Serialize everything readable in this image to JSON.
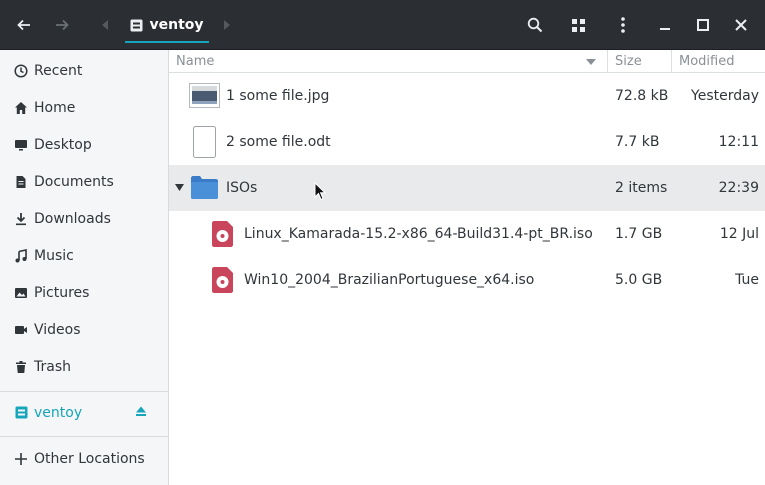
{
  "header": {
    "path_label": "ventoy"
  },
  "sidebar": {
    "items": [
      {
        "label": "Recent",
        "icon": "clock-icon"
      },
      {
        "label": "Home",
        "icon": "home-icon"
      },
      {
        "label": "Desktop",
        "icon": "desktop-icon"
      },
      {
        "label": "Documents",
        "icon": "document-icon"
      },
      {
        "label": "Downloads",
        "icon": "download-icon"
      },
      {
        "label": "Music",
        "icon": "music-icon"
      },
      {
        "label": "Pictures",
        "icon": "picture-icon"
      },
      {
        "label": "Videos",
        "icon": "video-icon"
      },
      {
        "label": "Trash",
        "icon": "trash-icon"
      }
    ],
    "device": {
      "label": "ventoy",
      "icon": "drive-icon"
    },
    "other": {
      "label": "Other Locations",
      "icon": "plus-icon"
    }
  },
  "columns": {
    "name": "Name",
    "size": "Size",
    "modified": "Modified"
  },
  "files": [
    {
      "name": "1 some file.jpg",
      "size": "72.8 kB",
      "modified": "Yesterday",
      "icon": "image-file-icon"
    },
    {
      "name": "2 some file.odt",
      "size": "7.7 kB",
      "modified": "12:11",
      "icon": "blank-file-icon"
    },
    {
      "name": "ISOs",
      "size": "2 items",
      "modified": "22:39",
      "icon": "folder-icon"
    },
    {
      "name": "Linux_Kamarada-15.2-x86_64-Build31.4-pt_BR.iso",
      "size": "1.7 GB",
      "modified": "12 Jul",
      "icon": "disc-image-icon"
    },
    {
      "name": "Win10_2004_BrazilianPortuguese_x64.iso",
      "size": "5.0 GB",
      "modified": "Tue",
      "icon": "disc-image-icon"
    }
  ],
  "colors": {
    "accent": "#16a5bb",
    "header_bg": "#2b2e33",
    "folder": "#4a90d9",
    "iso": "#c9455c"
  }
}
